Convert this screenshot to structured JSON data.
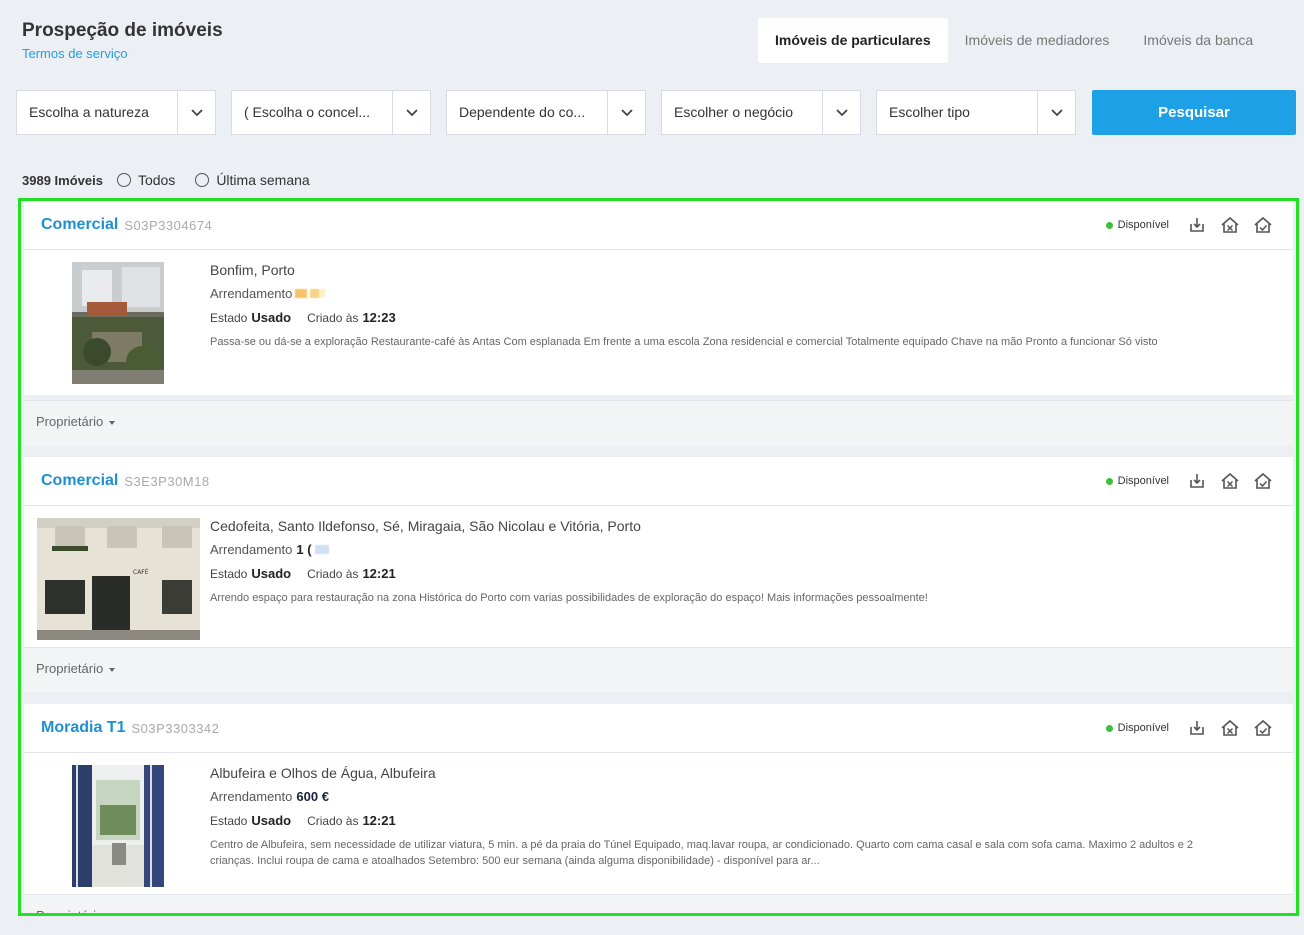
{
  "header": {
    "title": "Prospeção de imóveis",
    "terms_link": "Termos de serviço"
  },
  "tabs": [
    {
      "label": "Imóveis de particulares",
      "active": true
    },
    {
      "label": "Imóveis de mediadores",
      "active": false
    },
    {
      "label": "Imóveis da banca",
      "active": false
    }
  ],
  "filters": [
    {
      "value": "Escolha a natureza"
    },
    {
      "value": "( Escolha o concel..."
    },
    {
      "value": "Dependente do co..."
    },
    {
      "value": "Escolher o negócio"
    },
    {
      "value": "Escolher tipo"
    }
  ],
  "search_label": "Pesquisar",
  "results_count": "3989 Imóveis",
  "filter_radios": [
    "Todos",
    "Última semana"
  ],
  "accent_color": "#1ea0e6",
  "highlight_color": "#22e022",
  "listings": [
    {
      "title": "Comercial",
      "ref": "S03P3304674",
      "status": "Disponível",
      "location": "Bonfim, Porto",
      "business": "Arrendamento",
      "state_label": "Estado",
      "state": "Usado",
      "created_label": "Criado às",
      "created_time": "12:23",
      "description": "Passa-se ou dá-se a exploração Restaurante-café às Antas Com esplanada Em frente a uma escola Zona residencial e comercial Totalmente equipado Chave na mão Pronto a funcionar Só visto",
      "owner_label": "Proprietário"
    },
    {
      "title": "Comercial",
      "ref": "S3E3P30M18",
      "status": "Disponível",
      "location": "Cedofeita, Santo Ildefonso, Sé, Miragaia, São Nicolau e Vitória, Porto",
      "business": "Arrendamento",
      "price_partial": "1 (",
      "state_label": "Estado",
      "state": "Usado",
      "created_label": "Criado às",
      "created_time": "12:21",
      "description": "Arrendo espaço para restauração na zona Histórica do Porto com varias possibilidades de exploração do espaço! Mais informações pessoalmente!",
      "owner_label": "Proprietário"
    },
    {
      "title": "Moradia T1",
      "ref": "S03P3303342",
      "status": "Disponível",
      "location": "Albufeira e Olhos de Água, Albufeira",
      "business": "Arrendamento",
      "price_partial": "600 €",
      "state_label": "Estado",
      "state": "Usado",
      "created_label": "Criado às",
      "created_time": "12:21",
      "description": "Centro de Albufeira, sem necessidade de utilizar viatura, 5 min. a pé da praia do Túnel Equipado, maq.lavar roupa, ar condicionado. Quarto com cama casal e sala com sofa cama. Maximo 2 adultos e 2 crianças. Inclui roupa de cama e atoalhados Setembro: 500 eur semana (ainda alguma disponibilidade) - disponível para ar...",
      "owner_label": "Proprietário"
    }
  ]
}
